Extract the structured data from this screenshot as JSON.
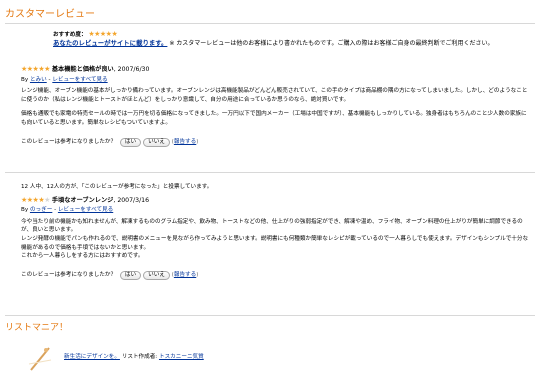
{
  "section_title": "カスタマーレビュー",
  "promo": {
    "label": "おすすめ度：",
    "rating": 5,
    "link": "あなたのレビューがサイトに載ります。",
    "note": "※ カスタマーレビューは他のお客様により書かれたものです。ご購入の際はお客様ご自身の最終判断でご利用ください。"
  },
  "reviews": [
    {
      "rating": 5,
      "title": "基本機能と価格が良い",
      "date": "2007/6/30",
      "by_label": "By",
      "author": "とみい",
      "separator": " - ",
      "see_all": "レビューをすべて見る",
      "date_sep": ", ",
      "body1": "レンジ機能、オーブン機能の基本がしっかり備わっています。オーブンレンジは高機能製品がどんどん販売されていて、この手のタイプは商品棚の隅の方になってしまいました。しかし、どのようなことに使うのか（私はレンジ機能とトーストがほとんど）をしっかり意識して、自分の用途に合っているか思うのなら、絶対買いです。",
      "body2": "価格も通販でも家電の特売セールの時では一万円を切る価格になってきました。一万円以下で国内メーカー（工場は中国ですが）、基本機能もしっかりしている。独身者はもちろんのこと少人数の家族にも向いていると思います。簡単なレシピもついていますよ。",
      "helpful_q": "このレビューは参考になりましたか？",
      "yes": "はい",
      "no": "いいえ",
      "report": "報告する"
    },
    {
      "votes": "12 人中、12人の方が、「このレビューが参考になった」と投票しています。",
      "rating": 4,
      "title": "手頃なオーブンレンジ",
      "date": "2007/3/16",
      "by_label": "By",
      "author": "のっぎー",
      "separator": " - ",
      "see_all": "レビューをすべて見る",
      "date_sep": ", ",
      "body1": "今や当たり前の機能かも知れませんが、解凍するもののグラム指定や、飲み物、トーストなどの他、仕上がりの強弱指定ができ、解凍や温め、フライ物、オーブン料理の仕上がりが簡単に調節できるのが、良いと思います。",
      "body2": "レンジ発酵の機能でパンも作れるので、説明書のメニューを見ながら作ってみようと思います。説明書にも何種類か簡単なレシピが載っているので一人暮らしでも使えます。デザインもシンプルで十分な機能があるので価格も手頃ではないかと思います。",
      "body3": "これから一人暮らしをする方にはおすすめです。",
      "helpful_q": "このレビューは参考になりましたか？",
      "yes": "はい",
      "no": "いいえ",
      "report": "報告する"
    }
  ],
  "listmania": {
    "title": "リストマニア！",
    "item_link": "新生活にデザインを。",
    "creator_label": "リスト作成者:",
    "creator": "トスカニーニ気質"
  },
  "colors": {
    "accent": "#e47911",
    "link": "#003399",
    "star": "#f3a52c"
  }
}
